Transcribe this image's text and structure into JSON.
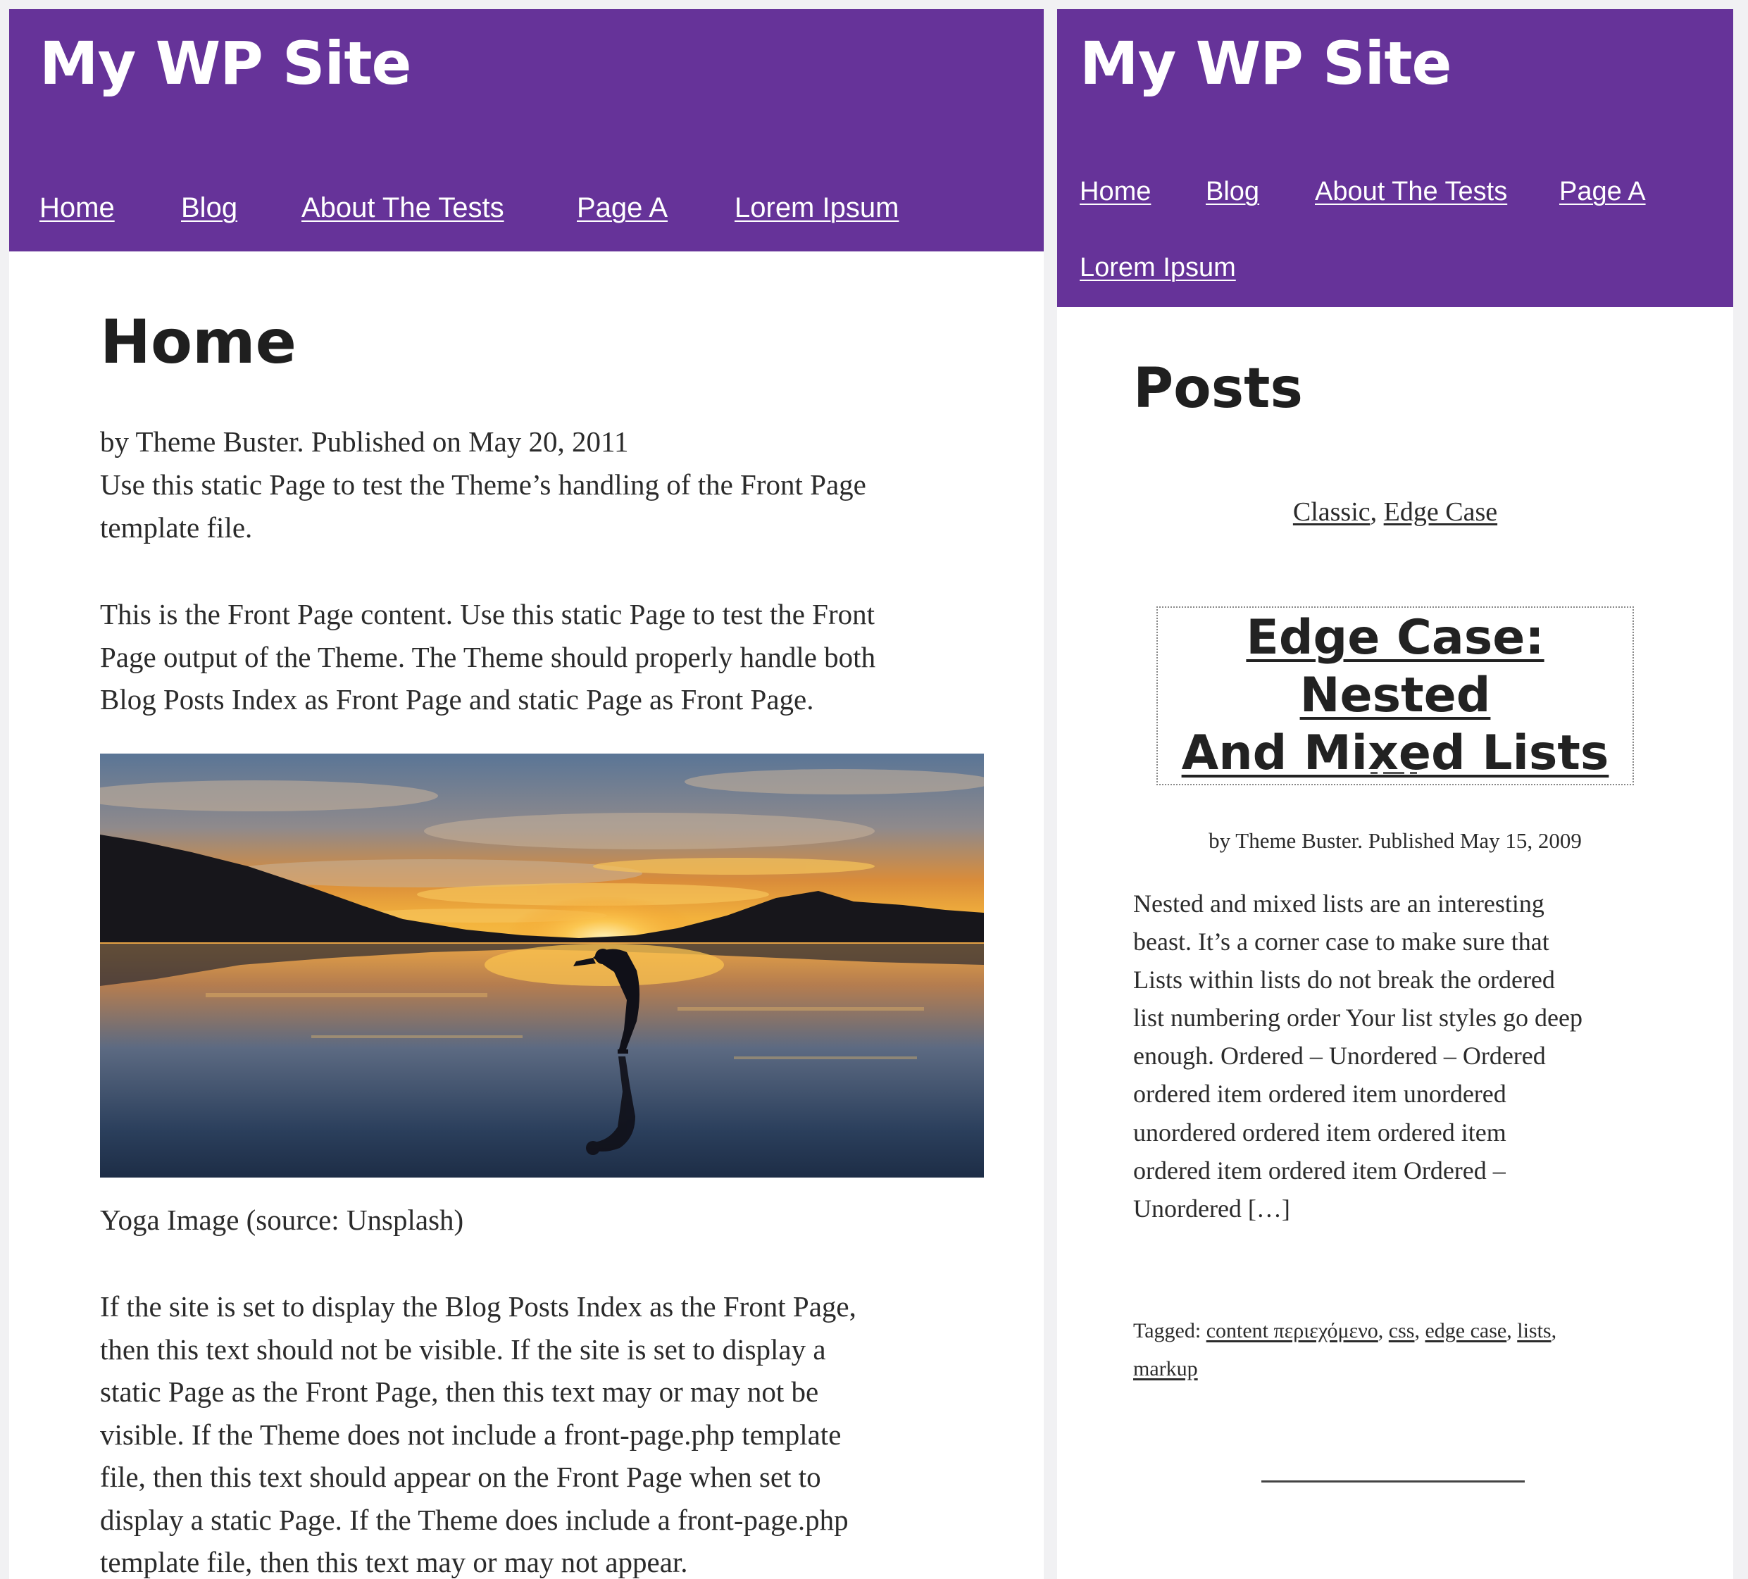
{
  "left": {
    "site_title": "My WP Site",
    "nav": [
      "Home",
      "Blog",
      "About The Tests",
      "Page A",
      "Lorem Ipsum"
    ],
    "page_title": "Home",
    "meta": "by Theme Buster. Published on May 20, 2011",
    "intro": [
      "Use this static Page to test the Theme’s handling of the Front Page",
      "template file."
    ],
    "content": [
      "This is the Front Page content. Use this static Page to test the Front",
      "Page output of the Theme. The Theme should properly handle both",
      "Blog Posts Index as Front Page and static Page as Front Page."
    ],
    "image_caption": "Yoga Image (source: Unsplash)",
    "closing": [
      "If the site is set to display the Blog Posts Index as the Front Page,",
      "then this text should not be visible. If the site is set to display a",
      "static Page as the Front Page, then this text may or may not be",
      "visible. If the Theme does not include a front-page.php template",
      "file, then this text should appear on the Front Page when set to",
      "display a static Page. If the Theme does include a front-page.php",
      "template file, then this text may or may not appear."
    ]
  },
  "right": {
    "site_title": "My WP Site",
    "nav": [
      "Home",
      "Blog",
      "About The Tests",
      "Page A",
      "Lorem Ipsum"
    ],
    "page_title": "Posts",
    "categories": [
      "Classic",
      "Edge Case"
    ],
    "category_separator": ", ",
    "post_title": [
      "Edge Case: Nested",
      "And Mixed Lists"
    ],
    "post_meta": "by Theme Buster. Published May 15, 2009",
    "excerpt": [
      "Nested and mixed lists are an interesting",
      "beast. It’s a corner case to make sure that",
      "Lists within lists do not break the ordered",
      "list numbering order Your list styles go deep",
      "enough. Ordered – Unordered – Ordered",
      "ordered item ordered item unordered",
      "unordered ordered item ordered item",
      "ordered item ordered item Ordered –",
      "Unordered […]"
    ],
    "tags_label": "Tagged:",
    "tags": [
      "content περιεχόμενο",
      "css",
      "edge case",
      "lists",
      "markup"
    ]
  },
  "colors": {
    "header_bg": "#663399",
    "header_text": "#ffffff",
    "body_text": "#2b2b2b",
    "page_bg": "#ffffff",
    "outer_bg": "#f1f1f3"
  }
}
